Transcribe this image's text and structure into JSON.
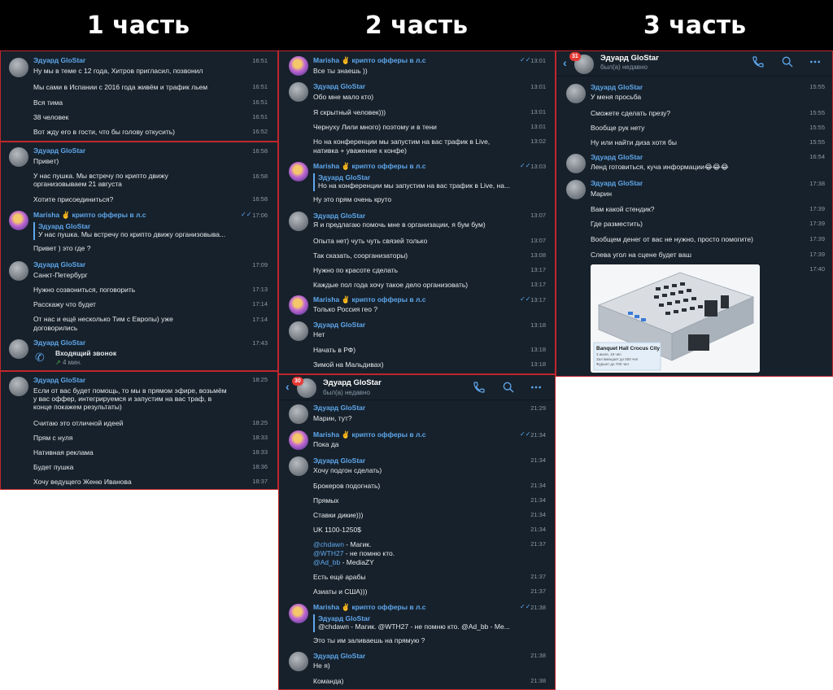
{
  "titles": [
    "1 часть",
    "2 часть",
    "3 часть"
  ],
  "colors": {
    "background": "#17212b",
    "accent": "#5ea7ec",
    "border": "#c0262d",
    "text": "#e6e9ec",
    "time": "#8a9aa9"
  },
  "part1": {
    "block1": [
      {
        "sender": "Эдуард GloStar",
        "text": "Ну мы в теме с 12 года, Хитров пригласил, позвонил",
        "time": "16:51"
      },
      {
        "text": "Мы сами в Испании с 2016 года живём и трафик льем",
        "time": "16:51"
      },
      {
        "text": "Вся тима",
        "time": "16:51"
      },
      {
        "text": "38 человек",
        "time": "16:51"
      },
      {
        "text": "Вот жду его в гости, что бы голову откусить)",
        "time": "16:52"
      }
    ],
    "block2": {
      "m1": {
        "sender": "Эдуард GloStar",
        "text": "Привет)",
        "time": "16:58"
      },
      "m2": {
        "line1": "У нас пушка. Мы встречу по крипто движу",
        "line2": "организовываем 21 августа",
        "time": "16:58"
      },
      "m3": {
        "text": "Хотите присоединиться?",
        "time": "16:58"
      },
      "m4": {
        "sender": "Marisha",
        "emoji": "✌️",
        "sender_rest": " крипто офферы в л.с",
        "quote_name": "Эдуард GloStar",
        "quote_text": "У нас пушка. Мы встречу по крипто движу организовыва...",
        "text": "Привет ) это где ?",
        "time": "17:06"
      },
      "m5": {
        "sender": "Эдуард GloStar",
        "text": "Санкт-Петербург",
        "time": "17:09"
      },
      "m6": {
        "text": "Нужно созвониться, поговорить",
        "time": "17:13"
      },
      "m7": {
        "text": "Расскажу что будет",
        "time": "17:14"
      },
      "m8": {
        "line1": "От нас и ещё несколько Тим с Европы) уже",
        "line2": "договорились",
        "time": "17:14"
      },
      "m9": {
        "sender": "Эдуард GloStar",
        "call_title": "Входящий звонок",
        "call_sub": "4 мин.",
        "time": "17:43"
      }
    },
    "block3": {
      "m1": {
        "sender": "Эдуард GloStar",
        "line1": "Если от вас будет помощь, то мы в прямом эфире, возьмём",
        "line2": "у вас оффер, интегрируемся и запустим на вас траф, в",
        "line3": "конце покажем результаты)",
        "time": "18:25"
      },
      "m2": {
        "text": "Считаю это отличной идеей",
        "time": "18:25"
      },
      "m3": {
        "text": "Прям с нуля",
        "time": "18:33"
      },
      "m4": {
        "text": "Нативная реклама",
        "time": "18:33"
      },
      "m5": {
        "text": "Будет пушка",
        "time": "18:36"
      },
      "m6": {
        "text": "Хочу ведущего Женю Иванова",
        "time": "18:37"
      }
    }
  },
  "part2a": {
    "m1": {
      "sender": "Marisha",
      "emoji": "✌️",
      "sender_rest": " крипто офферы в л.с",
      "text": "Все ты знаешь ))",
      "time": "13:01"
    },
    "m2": {
      "sender": "Эдуард GloStar",
      "text": "Обо мне мало кто)",
      "time": "13:01"
    },
    "m3": {
      "text": "Я скрытный человек)))",
      "time": "13:01"
    },
    "m4": {
      "text": "Чернуху Лили много) поэтому и в тени",
      "time": "13:01"
    },
    "m5": {
      "line1": "Но на конференции мы запустим на вас трафик в Live,",
      "line2": "нативка + уважение к конфе)",
      "time": "13:02"
    },
    "m6": {
      "sender": "Marisha",
      "emoji": "✌️",
      "sender_rest": " крипто офферы в л.с",
      "quote_name": "Эдуард GloStar",
      "quote_text": "Но на конференции мы запустим на вас трафик в Live, на...",
      "text": "Ну это прям очень круто",
      "time": "13:03"
    },
    "m7": {
      "sender": "Эдуард GloStar",
      "text": "Я и предлагаю помочь мне в организации, я бум бум)",
      "time": "13:07"
    },
    "m8": {
      "text": "Опыта нет) чуть чуть связей только",
      "time": "13:07"
    },
    "m9": {
      "text": "Так сказать, соорганизаторы)",
      "time": "13:08"
    },
    "m10": {
      "text": "Нужно по красоте сделать",
      "time": "13:17"
    },
    "m11": {
      "text": "Каждые пол года хочу такое дело организовать)",
      "time": "13:17"
    },
    "m12": {
      "sender": "Marisha",
      "emoji": "✌️",
      "sender_rest": " крипто офферы в л.с",
      "text": "Только Россия гео ?",
      "time": "13:17"
    },
    "m13": {
      "sender": "Эдуард GloStar",
      "text": "Нет",
      "time": "13:18"
    },
    "m14": {
      "text": "Начать в РФ)",
      "time": "13:18"
    },
    "m15": {
      "text": "Зимой на Мальдивах)",
      "time": "13:18"
    }
  },
  "part2b": {
    "header": {
      "badge": "30",
      "name": "Эдуард GloStar",
      "status": "был(а) недавно"
    },
    "m1": {
      "sender": "Эдуард GloStar",
      "text": "Марин, тут?",
      "time": "21:29"
    },
    "m2": {
      "sender": "Marisha",
      "emoji": "✌️",
      "sender_rest": " крипто офферы в л.с",
      "text": "Пока да",
      "time": "21:34"
    },
    "m3": {
      "sender": "Эдуард GloStar",
      "text": "Хочу подгон сделать)",
      "time": "21:34"
    },
    "m4": {
      "text": "Брокеров подогнать)",
      "time": "21:34"
    },
    "m5": {
      "text": "Прямых",
      "time": "21:34"
    },
    "m6": {
      "text": "Ставки дикие)))",
      "time": "21:34"
    },
    "m7": {
      "text": "UK 1100-1250$",
      "time": "21:34"
    },
    "m8": {
      "l1_link": "@chdawn",
      "l1_rest": " - Магик.",
      "l2_link": "@WTH27",
      "l2_rest": " - не помню кто.",
      "l3_link": "@Ad_bb",
      "l3_rest": " - MediaZY",
      "time": "21:37"
    },
    "m9": {
      "text": "Есть ещё арабы",
      "time": "21:37"
    },
    "m10": {
      "text": "Азиаты и США)))",
      "time": "21:37"
    },
    "m11": {
      "sender": "Marisha",
      "emoji": "✌️",
      "sender_rest": " крипто офферы в л.с",
      "quote_name": "Эдуард GloStar",
      "quote_text": "@chdawn - Магик. @WTH27 - не помню кто. @Ad_bb - Ме...",
      "text": "Это ты им заливаешь на прямую ?",
      "time": "21:38"
    },
    "m12": {
      "sender": "Эдуард GloStar",
      "text": "Не я)",
      "time": "21:38"
    },
    "m13": {
      "text": "Команда)",
      "time": "21:38"
    }
  },
  "part3": {
    "header": {
      "badge": "31",
      "name": "Эдуард GloStar",
      "status": "был(а) недавно"
    },
    "m1": {
      "sender": "Эдуард GloStar",
      "text": "У меня просьба",
      "time": "15:55"
    },
    "m2": {
      "text": "Сможете сделать презу?",
      "time": "15:55"
    },
    "m3": {
      "text": "Вообще рук нету",
      "time": "15:55"
    },
    "m4": {
      "text": "Ну или найти диза хотя бы",
      "time": "15:55"
    },
    "m5": {
      "sender": "Эдуард GloStar",
      "text": "Ленд готовиться, куча информации😂😂😂",
      "time": "16:54"
    },
    "m6": {
      "sender": "Эдуард GloStar",
      "text": "Марин",
      "time": "17:38"
    },
    "m7": {
      "text": "Вам какой стендик?",
      "time": "17:39"
    },
    "m8": {
      "text": "Где разместить)",
      "time": "17:39"
    },
    "m9": {
      "text": "Вообщем денег от вас не нужно, просто помогите)",
      "time": "17:39"
    },
    "m10": {
      "text": "Слева угол на сцене будет ваш",
      "time": "17:39"
    },
    "m11": {
      "time": "17:40",
      "image_title": "Banquet Hall Crocus City",
      "image_sub1": "3 июля, 19 чел",
      "image_sub2": "Зал вмещает до 500 чел",
      "image_sub3": "Фуршет до 700 чел"
    }
  }
}
